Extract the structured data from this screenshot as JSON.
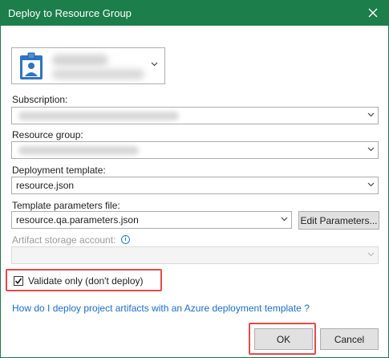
{
  "dialog": {
    "title": "Deploy to Resource Group",
    "close_glyph": "✕"
  },
  "account": {
    "icon": "user-badge-icon",
    "redacted": true
  },
  "subscription": {
    "label": "Subscription:",
    "value_redacted": true
  },
  "resource_group": {
    "label": "Resource group:",
    "value_redacted": true
  },
  "deployment_template": {
    "label": "Deployment template:",
    "value": "resource.json"
  },
  "template_parameters": {
    "label": "Template parameters file:",
    "value": "resource.qa.parameters.json",
    "edit_button": "Edit Parameters..."
  },
  "artifact_storage": {
    "label": "Artifact storage account:",
    "info_icon": "info-icon",
    "info_glyph": "i",
    "value": ""
  },
  "validate_only": {
    "label": "Validate only (don't deploy)",
    "checked": true,
    "check_glyph": "✓"
  },
  "help_link": {
    "text": "How do I deploy project artifacts with an Azure deployment template ?"
  },
  "buttons": {
    "ok": "OK",
    "cancel": "Cancel"
  },
  "colors": {
    "titlebar": "#1c7e4b",
    "highlight": "#e24b4b",
    "link": "#1a6fc9"
  }
}
